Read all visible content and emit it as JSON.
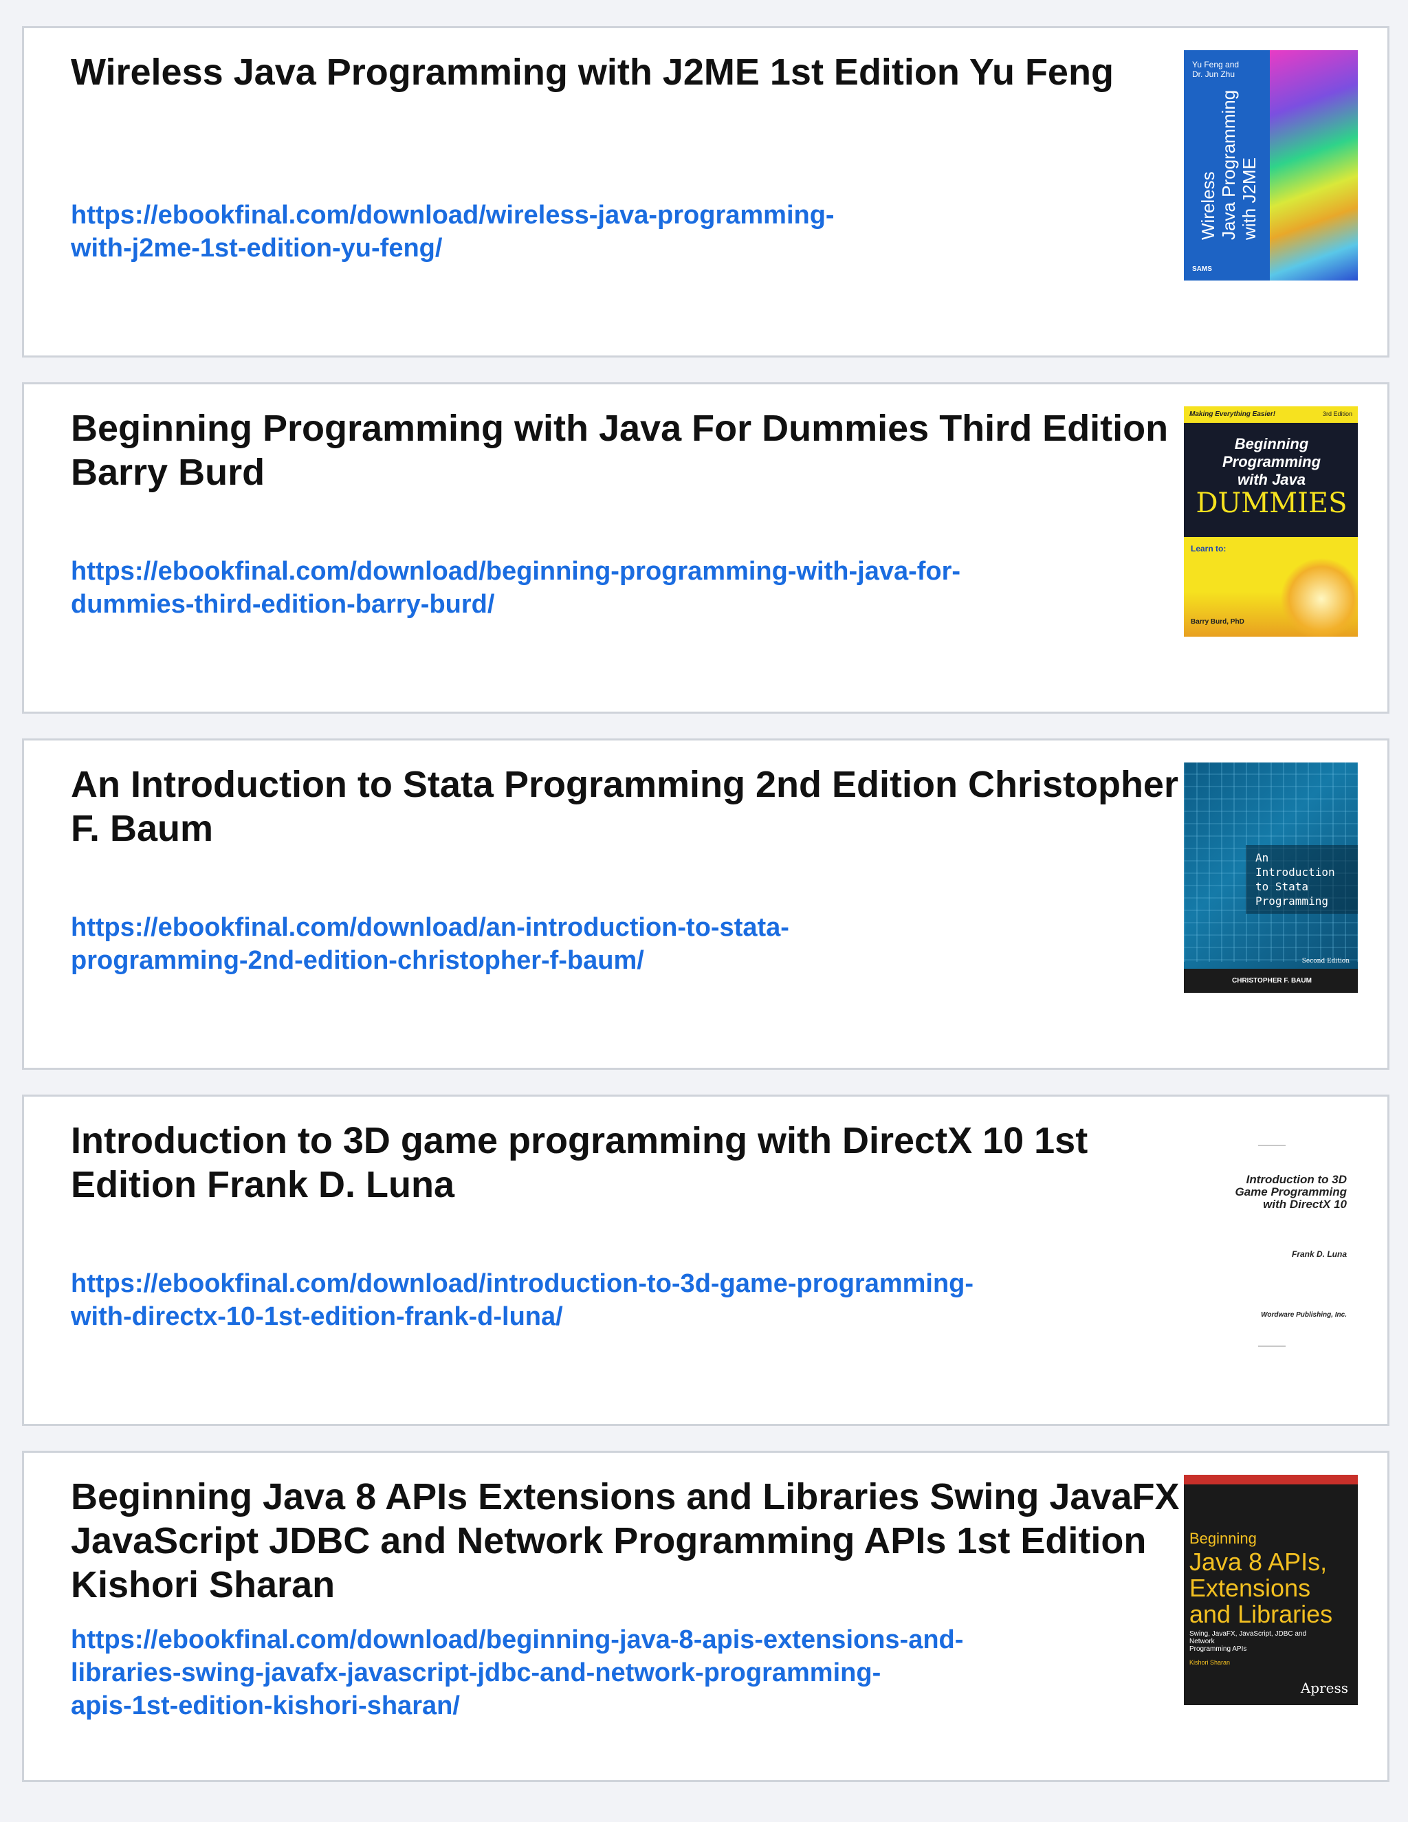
{
  "books": [
    {
      "title": "Wireless Java Programming with J2ME 1st Edition Yu Feng",
      "url_lines": "https://ebookfinal.com/download/wireless-java-programming-\nwith-j2me-1st-edition-yu-feng/",
      "cover": {
        "authors": "Yu Feng and\nDr. Jun Zhu",
        "title": "Wireless\nJava Programming\nwith J2ME",
        "publisher": "SAMS"
      }
    },
    {
      "title": "Beginning Programming with Java For Dummies Third Edition Barry Burd",
      "url_lines": "https://ebookfinal.com/download/beginning-programming-with-java-for-\ndummies-third-edition-barry-burd/",
      "cover": {
        "tagline": "Making Everything Easier!",
        "edition": "3rd Edition",
        "title": "Beginning Programming\nwith Java",
        "dummies": "DUMMIES",
        "learn": "Learn to:",
        "author": "Barry Burd, PhD"
      }
    },
    {
      "title": "An Introduction to Stata Programming 2nd Edition Christopher F. Baum",
      "url_lines": "https://ebookfinal.com/download/an-introduction-to-stata-\nprogramming-2nd-edition-christopher-f-baum/",
      "cover": {
        "title": "An\nIntroduction\nto Stata\nProgramming",
        "edition": "Second Edition",
        "author": "CHRISTOPHER F. BAUM"
      }
    },
    {
      "title": "Introduction to 3D game programming with DirectX 10 1st Edition Frank D. Luna",
      "url_lines": "https://ebookfinal.com/download/introduction-to-3d-game-programming-\nwith-directx-10-1st-edition-frank-d-luna/",
      "cover": {
        "title": "Introduction to 3D\nGame Programming\nwith DirectX 10",
        "author": "Frank D. Luna",
        "publisher": "Wordware Publishing, Inc."
      }
    },
    {
      "title": "Beginning Java 8 APIs Extensions and Libraries Swing JavaFX JavaScript JDBC and Network Programming APIs 1st Edition Kishori Sharan",
      "url_lines": "https://ebookfinal.com/download/beginning-java-8-apis-extensions-and-\nlibraries-swing-javafx-javascript-jdbc-and-network-programming-\napis-1st-edition-kishori-sharan/",
      "cover": {
        "beginning": "Beginning",
        "big": "Java 8 APIs,\nExtensions\nand Libraries",
        "subtitle": "Swing, JavaFX, JavaScript, JDBC and Network\nProgramming APIs",
        "author": "Kishori Sharan",
        "publisher": "Apress"
      }
    }
  ],
  "colors": {
    "link": "#1a6ce0",
    "card_border": "#cfd3da",
    "background": "#f2f3f7"
  }
}
